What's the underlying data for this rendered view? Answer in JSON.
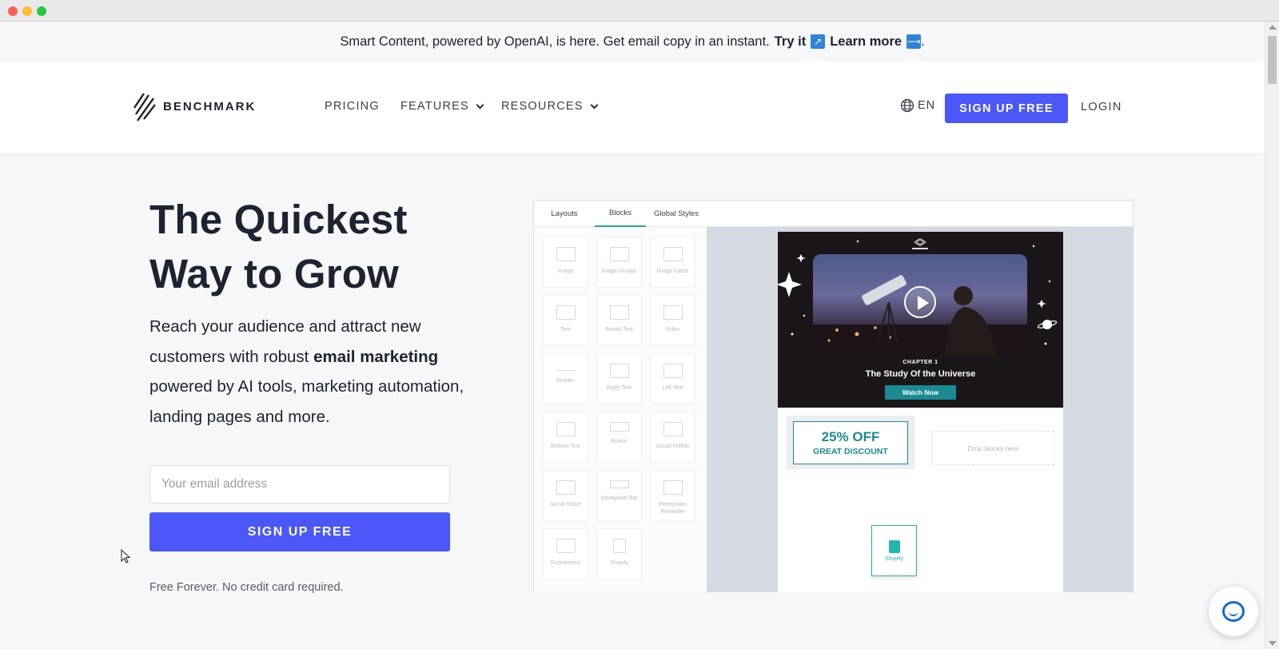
{
  "announcement": {
    "text": "Smart Content, powered by OpenAI, is here. Get email copy in an instant.",
    "try_label": "Try it",
    "try_icon": "arrow-up-right-icon",
    "learn_label": "Learn more",
    "learn_icon": "arrow-right-icon",
    "end": "."
  },
  "nav": {
    "logo_text": "BENCHMARK",
    "items": [
      {
        "label": "PRICING",
        "has_dropdown": false
      },
      {
        "label": "FEATURES",
        "has_dropdown": true
      },
      {
        "label": "RESOURCES",
        "has_dropdown": true
      }
    ],
    "language": "EN",
    "signup_label": "SIGN UP FREE",
    "login_label": "LOGIN"
  },
  "hero": {
    "headline_line1": "The Quickest",
    "headline_line2": "Way to Grow",
    "sub_before": "Reach your audience and attract new customers with robust",
    "sub_bold": "email marketing",
    "sub_after": "powered by AI tools, marketing automation, landing pages and more.",
    "email_placeholder": "Your email address",
    "signup_label": "SIGN UP FREE",
    "note": "Free Forever. No credit card required."
  },
  "builder": {
    "tabs": [
      "Layouts",
      "Blocks",
      "Global Styles"
    ],
    "active_tab": "Blocks",
    "blocks": [
      "Image",
      "Image Groups",
      "Image Cards",
      "Text",
      "Boxed Text",
      "Video",
      "Divider",
      "Right Text",
      "Left Text",
      "Bottom Text",
      "Button",
      "Social Follow",
      "Social Share",
      "Navigation Bar",
      "Permission Reminder",
      "Ecommerce",
      "Shopify"
    ],
    "email": {
      "brand": "LEARNING SPACE",
      "chapter": "CHAPTER 1",
      "title": "The Study Of the Universe",
      "cta": "Watch Now",
      "discount_big": "25% OFF",
      "discount_small": "GREAT DISCOUNT",
      "dropzone": "Drop blocks here"
    },
    "drag_tile_label": "Shopify"
  },
  "colors": {
    "primary": "#4b57f6",
    "teal": "#1a8a93",
    "shopify_green": "#23b5a9",
    "chat_blue": "#1469d9"
  }
}
